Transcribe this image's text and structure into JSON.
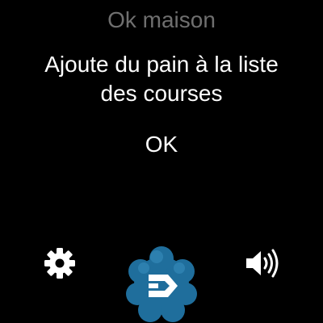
{
  "header": {
    "title": "Ok maison"
  },
  "conversation": {
    "command": "Ajoute du pain à la liste des courses",
    "response": "OK"
  },
  "controls": {
    "settings_icon": "gear-icon",
    "assistant_icon": "assistant-logo-icon",
    "volume_icon": "speaker-volume-icon"
  },
  "colors": {
    "background": "#000000",
    "header_text": "#6f6f6f",
    "text": "#ffffff",
    "logo_blob": "#1f6e9c",
    "logo_blob_light": "#3a8fc0"
  }
}
